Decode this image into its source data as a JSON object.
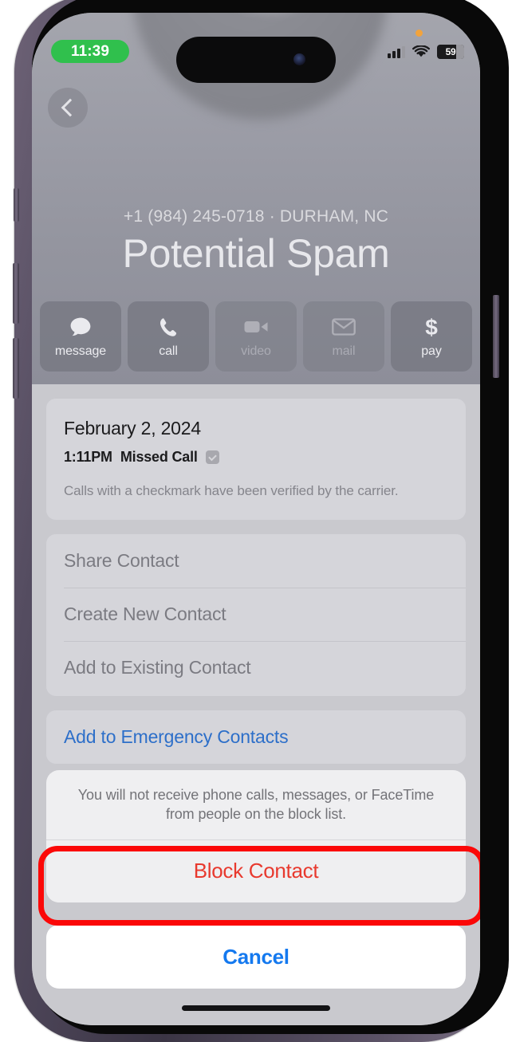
{
  "status_bar": {
    "time": "11:39",
    "time_pill_color": "#30c04d",
    "battery_percent": "59",
    "icons": [
      "orange-recording-dot",
      "cellular-signal",
      "wifi",
      "battery"
    ]
  },
  "header": {
    "back_label": "Back",
    "subtitle": "+1 (984) 245-0718 · DURHAM, NC",
    "name": "Potential Spam",
    "actions": [
      {
        "label": "message",
        "icon": "message-bubble-icon",
        "disabled": false
      },
      {
        "label": "call",
        "icon": "phone-icon",
        "disabled": false
      },
      {
        "label": "video",
        "icon": "video-camera-icon",
        "disabled": true
      },
      {
        "label": "mail",
        "icon": "envelope-icon",
        "disabled": true
      },
      {
        "label": "pay",
        "icon": "dollar-sign-icon",
        "disabled": false
      }
    ]
  },
  "call_log": {
    "date": "February 2, 2024",
    "time": "1:11PM",
    "type": "Missed Call",
    "verified_badge": "checkmark-badge-icon",
    "note": "Calls with a checkmark have been verified by the carrier."
  },
  "options": [
    {
      "label": "Share Contact"
    },
    {
      "label": "Create New Contact"
    },
    {
      "label": "Add to Existing Contact"
    }
  ],
  "emergency": {
    "label": "Add to Emergency Contacts",
    "color": "#2d6fc9"
  },
  "action_sheet": {
    "message": "You will not receive phone calls, messages, or FaceTime from people on the block list.",
    "block_label": "Block Contact",
    "block_color": "#e8392e",
    "cancel_label": "Cancel",
    "cancel_color": "#1479ef",
    "highlight_color": "#fb0808"
  }
}
